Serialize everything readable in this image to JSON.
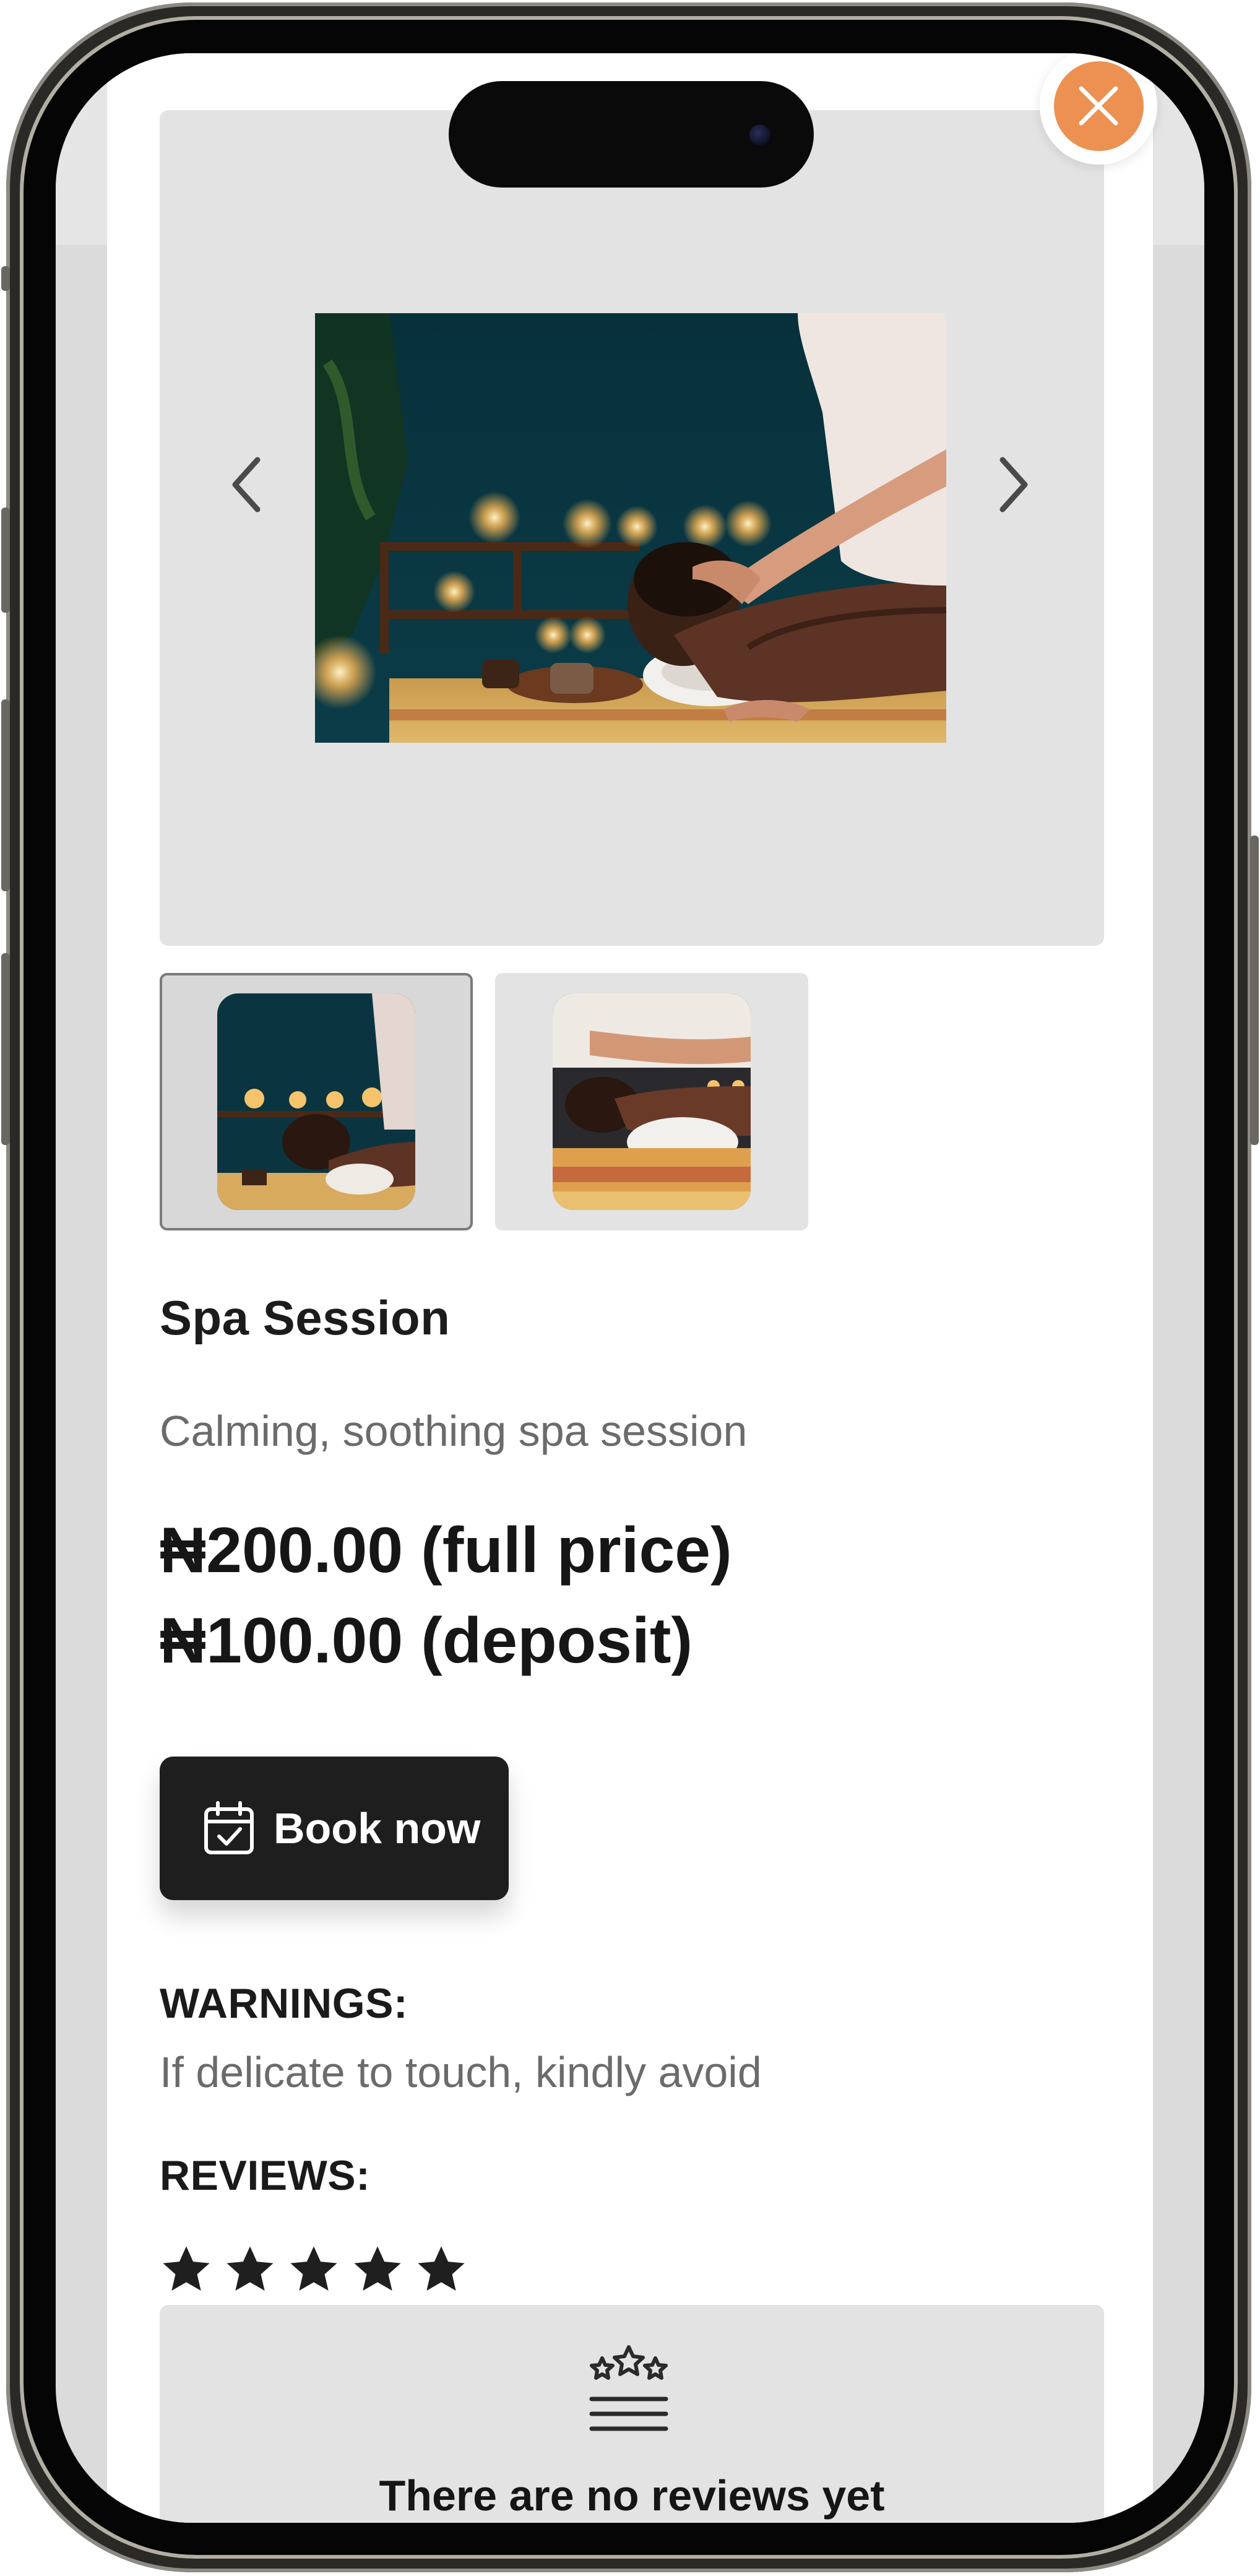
{
  "modal": {
    "close_icon": "close-icon",
    "accent_color": "#ec9152"
  },
  "gallery": {
    "main_image": "spa-massage-photo",
    "prev_icon": "chevron-left-icon",
    "next_icon": "chevron-right-icon",
    "thumbnails": [
      "spa-massage-thumbnail-1",
      "spa-massage-thumbnail-2"
    ],
    "active_thumbnail": 1
  },
  "service": {
    "title": "Spa Session",
    "description": "Calming, soothing spa session",
    "full_price": "₦200.00 (full price)",
    "deposit_price": "₦100.00 (deposit)"
  },
  "actions": {
    "book_label": "Book now",
    "book_icon": "calendar-check-icon"
  },
  "warnings": {
    "heading": "WARNINGS:",
    "text": "If delicate to touch, kindly avoid"
  },
  "reviews": {
    "heading": "REVIEWS:",
    "rating": 5,
    "max_rating": 5,
    "empty_icon": "stars-review-icon",
    "empty_text": "There are no reviews yet"
  }
}
